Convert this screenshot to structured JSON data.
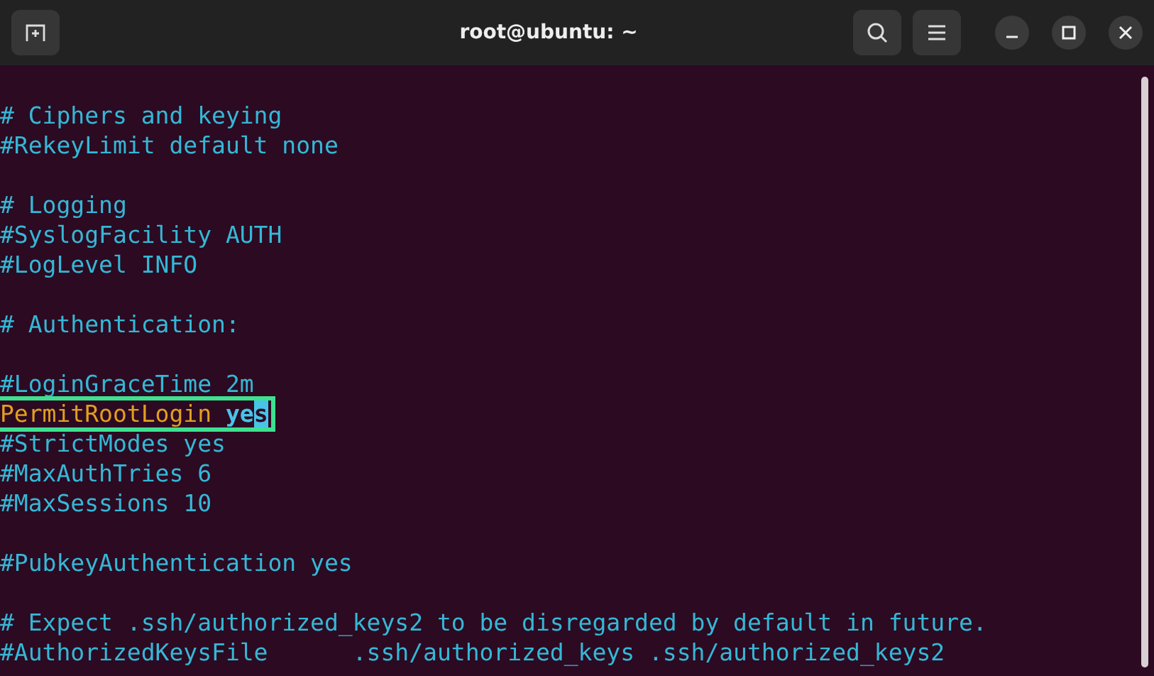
{
  "window": {
    "title": "root@ubuntu: ~"
  },
  "lines": [
    {
      "kind": "blank"
    },
    {
      "kind": "comment",
      "text": "# Ciphers and keying"
    },
    {
      "kind": "comment",
      "text": "#RekeyLimit default none"
    },
    {
      "kind": "blank"
    },
    {
      "kind": "comment",
      "text": "# Logging"
    },
    {
      "kind": "comment",
      "text": "#SyslogFacility AUTH"
    },
    {
      "kind": "comment",
      "text": "#LogLevel INFO"
    },
    {
      "kind": "blank"
    },
    {
      "kind": "comment",
      "text": "# Authentication:"
    },
    {
      "kind": "blank"
    },
    {
      "kind": "comment",
      "text": "#LoginGraceTime 2m"
    },
    {
      "kind": "setting",
      "key": "PermitRootLogin",
      "value_head": "ye",
      "value_cursor": "s",
      "highlighted": true
    },
    {
      "kind": "comment",
      "text": "#StrictModes yes"
    },
    {
      "kind": "comment",
      "text": "#MaxAuthTries 6"
    },
    {
      "kind": "comment",
      "text": "#MaxSessions 10"
    },
    {
      "kind": "blank"
    },
    {
      "kind": "comment",
      "text": "#PubkeyAuthentication yes"
    },
    {
      "kind": "blank"
    },
    {
      "kind": "comment",
      "text": "# Expect .ssh/authorized_keys2 to be disregarded by default in future."
    },
    {
      "kind": "comment",
      "text": "#AuthorizedKeysFile      .ssh/authorized_keys .ssh/authorized_keys2"
    }
  ]
}
